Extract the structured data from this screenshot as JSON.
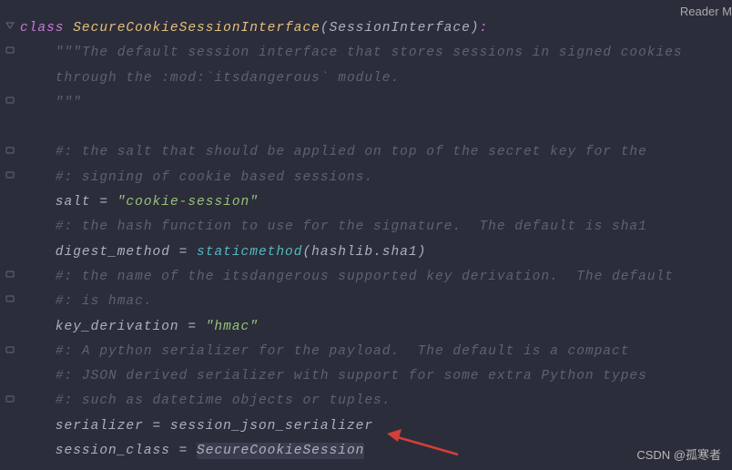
{
  "header": {
    "reader_mode": "Reader M"
  },
  "watermark": "CSDN @孤寒者",
  "code": {
    "l1_kw": "class",
    "l1_name": "SecureCookieSessionInterface",
    "l1_paren_open": "(",
    "l1_param": "SessionInterface",
    "l1_paren_close": ")",
    "l1_colon": ":",
    "l2": "    \"\"\"The default session interface that stores sessions in signed cookies",
    "l3": "    through the :mod:`itsdangerous` module.",
    "l4": "    \"\"\"",
    "l5": "",
    "l6": "    #: the salt that should be applied on top of the secret key for the",
    "l7": "    #: signing of cookie based sessions.",
    "l8_ident": "    salt ",
    "l8_eq": "=",
    "l8_str": " \"cookie-session\"",
    "l9": "    #: the hash function to use for the signature.  The default is sha1",
    "l10_ident": "    digest_method ",
    "l10_eq": "=",
    "l10_func": " staticmethod",
    "l10_rest_open": "(",
    "l10_attr1": "hashlib",
    "l10_dot": ".",
    "l10_attr2": "sha1",
    "l10_rest_close": ")",
    "l11": "    #: the name of the itsdangerous supported key derivation.  The default",
    "l12": "    #: is hmac.",
    "l13_ident": "    key_derivation ",
    "l13_eq": "=",
    "l13_str": " \"hmac\"",
    "l14": "    #: A python serializer for the payload.  The default is a compact",
    "l15": "    #: JSON derived serializer with support for some extra Python types",
    "l16": "    #: such as datetime objects or tuples.",
    "l17_ident": "    serializer ",
    "l17_eq": "=",
    "l17_val": " session_json_serializer",
    "l18_ident": "    session_class ",
    "l18_eq": "=",
    "l18_val": " SecureCookieSession"
  }
}
